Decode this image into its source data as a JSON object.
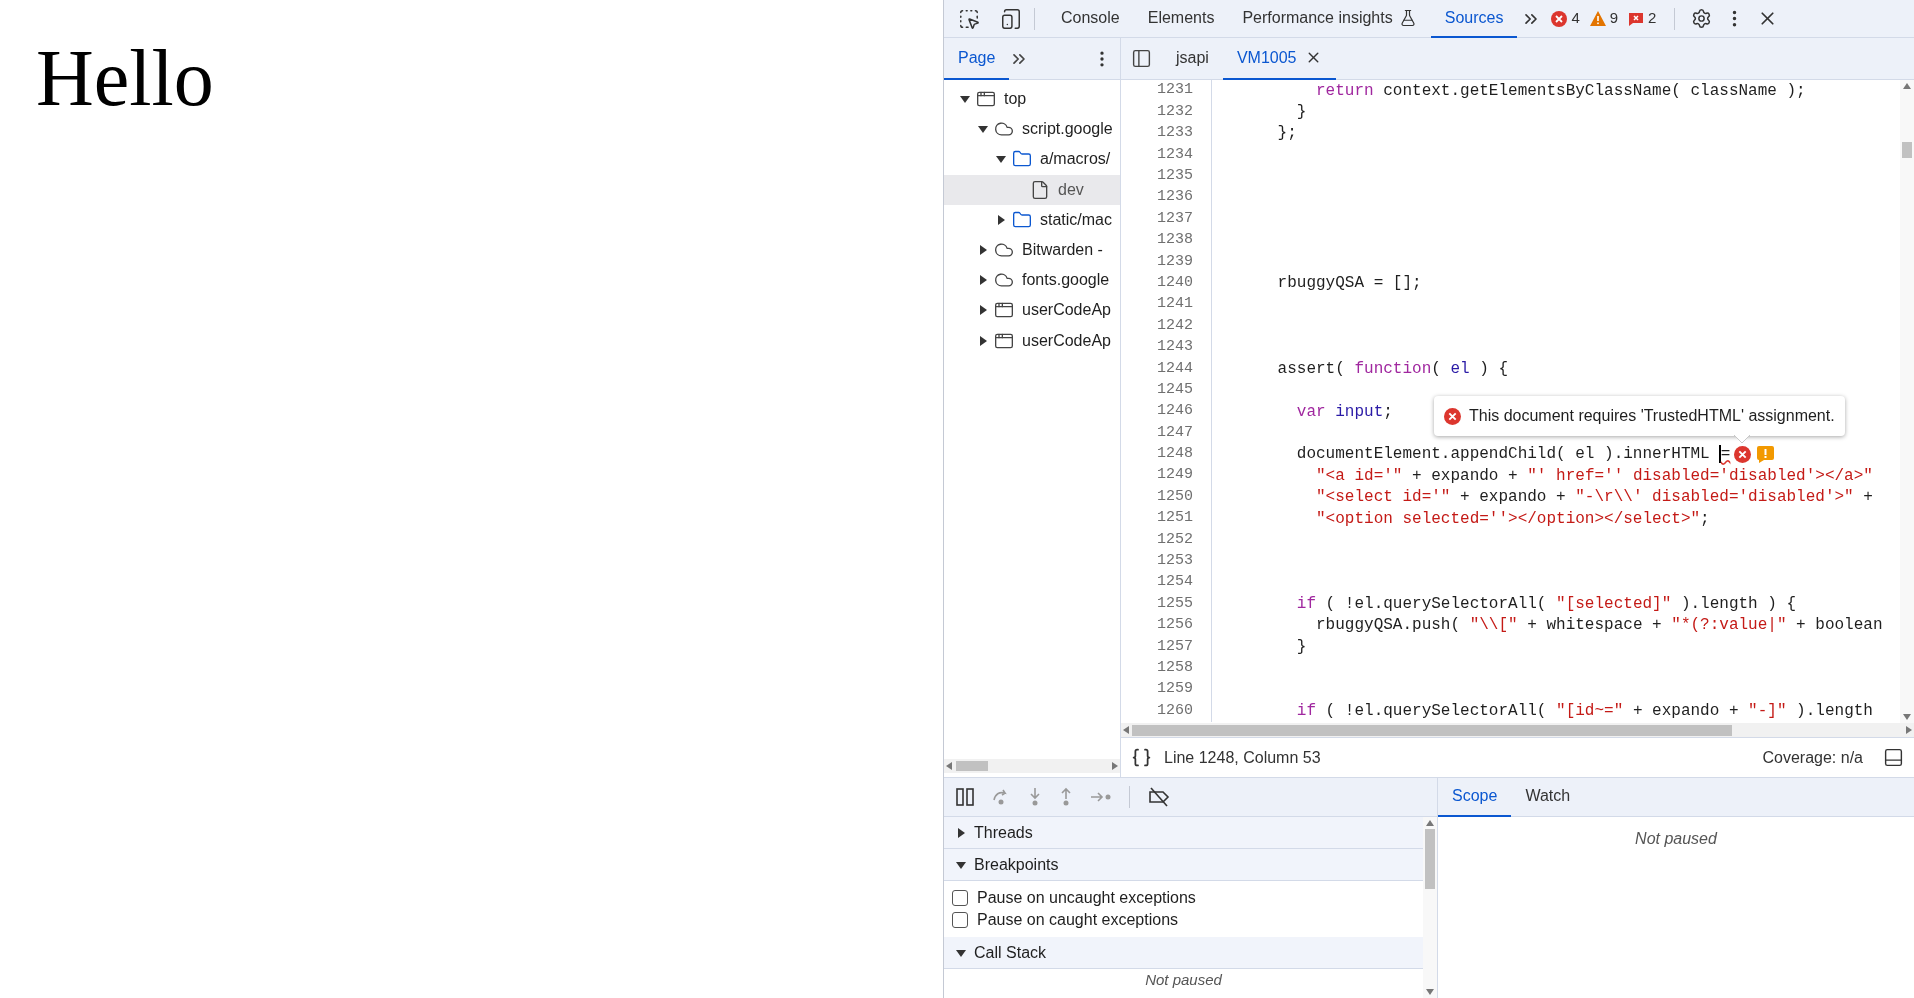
{
  "page": {
    "heading": "Hello"
  },
  "devtools": {
    "main_tabs": [
      {
        "label": "Console",
        "selected": false,
        "kind": "plain"
      },
      {
        "label": "Elements",
        "selected": false,
        "kind": "plain"
      },
      {
        "label": "Performance insights",
        "selected": false,
        "kind": "experimental"
      },
      {
        "label": "Sources",
        "selected": true,
        "kind": "plain"
      }
    ],
    "counters": [
      {
        "kind": "error",
        "count": "4"
      },
      {
        "kind": "warning",
        "count": "9"
      },
      {
        "kind": "issue",
        "count": "2"
      }
    ],
    "navigator": {
      "tabs": [
        {
          "label": "Page",
          "selected": true
        }
      ],
      "tree": [
        {
          "label": "top",
          "kind": "frame",
          "expanded": true,
          "selected": false,
          "children": [
            {
              "label": "script.google",
              "kind": "domain",
              "expanded": true,
              "selected": false,
              "children": [
                {
                  "label": "a/macros/",
                  "kind": "folder",
                  "expanded": true,
                  "selected": false,
                  "children": [
                    {
                      "label": "dev",
                      "kind": "file",
                      "selected": true
                    }
                  ]
                },
                {
                  "label": "static/mac",
                  "kind": "folder",
                  "expanded": false,
                  "selected": false
                }
              ]
            },
            {
              "label": "Bitwarden -",
              "kind": "domain",
              "expanded": false,
              "selected": false
            },
            {
              "label": "fonts.google",
              "kind": "domain",
              "expanded": false,
              "selected": false
            },
            {
              "label": "userCodeAp",
              "kind": "frame",
              "expanded": false,
              "selected": false
            },
            {
              "label": "userCodeAp",
              "kind": "frame",
              "expanded": false,
              "selected": false
            }
          ]
        }
      ]
    },
    "editor_tabs": [
      {
        "label": "jsapi",
        "selected": false,
        "closable": false
      },
      {
        "label": "VM1005",
        "selected": true,
        "closable": true
      }
    ],
    "code_lines": [
      {
        "number": "1231",
        "tokens": [
          {
            "text": "          return",
            "kind": "kw"
          },
          {
            "text": " context.getElementsByClassName( className );",
            "kind": "p"
          }
        ]
      },
      {
        "number": "1232",
        "tokens": [
          {
            "text": "        }",
            "kind": "p"
          }
        ]
      },
      {
        "number": "1233",
        "tokens": [
          {
            "text": "      };",
            "kind": "p"
          }
        ]
      },
      {
        "number": "1234"
      },
      {
        "number": "1235"
      },
      {
        "number": "1236"
      },
      {
        "number": "1237"
      },
      {
        "number": "1238"
      },
      {
        "number": "1239"
      },
      {
        "number": "1240",
        "tokens": [
          {
            "text": "      rbuggyQSA = [];",
            "kind": "p"
          }
        ]
      },
      {
        "number": "1241"
      },
      {
        "number": "1242"
      },
      {
        "number": "1243"
      },
      {
        "number": "1244",
        "tokens": [
          {
            "text": "      assert( ",
            "kind": "p"
          },
          {
            "text": "function",
            "kind": "kw"
          },
          {
            "text": "( ",
            "kind": "p"
          },
          {
            "text": "el",
            "kind": "var"
          },
          {
            "text": " ) {",
            "kind": "p"
          }
        ]
      },
      {
        "number": "1245"
      },
      {
        "number": "1246",
        "tokens": [
          {
            "text": "        var",
            "kind": "kw"
          },
          {
            "text": " input",
            "kind": "var"
          },
          {
            "text": ";",
            "kind": "p"
          }
        ]
      },
      {
        "number": "1247"
      },
      {
        "number": "1248",
        "tokens": [
          {
            "text": "        documentElement.appendChild( el ).innerHTML ",
            "kind": "p"
          },
          {
            "kind": "cursor"
          },
          {
            "text": "=",
            "kind": "err"
          }
        ],
        "markers": [
          {
            "kind": "error"
          },
          {
            "kind": "warning"
          }
        ]
      },
      {
        "number": "1249",
        "tokens": [
          {
            "text": "          \"<a id='\"",
            "kind": "str"
          },
          {
            "text": " + expando + ",
            "kind": "p"
          },
          {
            "text": "\"' href='' disabled='disabled'></a>\"",
            "kind": "str"
          }
        ]
      },
      {
        "number": "1250",
        "tokens": [
          {
            "text": "          \"<select id='\"",
            "kind": "str"
          },
          {
            "text": " + expando + ",
            "kind": "p"
          },
          {
            "text": "\"-\\r\\\\' disabled='disabled'>\"",
            "kind": "str"
          },
          {
            "text": " +",
            "kind": "p"
          }
        ]
      },
      {
        "number": "1251",
        "tokens": [
          {
            "text": "          \"<option selected=''></option></select>\"",
            "kind": "str"
          },
          {
            "text": ";",
            "kind": "p"
          }
        ]
      },
      {
        "number": "1252"
      },
      {
        "number": "1253"
      },
      {
        "number": "1254"
      },
      {
        "number": "1255",
        "tokens": [
          {
            "text": "        if",
            "kind": "kw"
          },
          {
            "text": " ( !el.querySelectorAll( ",
            "kind": "p"
          },
          {
            "text": "\"[selected]\"",
            "kind": "str"
          },
          {
            "text": " ).length ) {",
            "kind": "p"
          }
        ]
      },
      {
        "number": "1256",
        "tokens": [
          {
            "text": "          rbuggyQSA.push( ",
            "kind": "p"
          },
          {
            "text": "\"\\\\[\"",
            "kind": "str"
          },
          {
            "text": " + whitespace + ",
            "kind": "p"
          },
          {
            "text": "\"*(?:value|\"",
            "kind": "str"
          },
          {
            "text": " + boolean",
            "kind": "p"
          }
        ]
      },
      {
        "number": "1257",
        "tokens": [
          {
            "text": "        }",
            "kind": "p"
          }
        ]
      },
      {
        "number": "1258"
      },
      {
        "number": "1259"
      },
      {
        "number": "1260",
        "tokens": [
          {
            "text": "        if",
            "kind": "kw"
          },
          {
            "text": " ( !el.querySelectorAll( ",
            "kind": "p"
          },
          {
            "text": "\"[id~=\"",
            "kind": "str"
          },
          {
            "text": " + expando + ",
            "kind": "p"
          },
          {
            "text": "\"-]\"",
            "kind": "str"
          },
          {
            "text": " ).length",
            "kind": "p"
          }
        ]
      }
    ],
    "tooltip": {
      "kind": "error",
      "message": "This document requires 'TrustedHTML' assignment."
    },
    "status_bar": {
      "position": "Line 1248, Column 53",
      "coverage": "Coverage: n/a"
    },
    "debugger": {
      "sections": [
        {
          "title": "Threads",
          "expanded": false
        },
        {
          "title": "Breakpoints",
          "expanded": true,
          "options": [
            {
              "label": "Pause on uncaught exceptions",
              "checked": false
            },
            {
              "label": "Pause on caught exceptions",
              "checked": false
            }
          ]
        },
        {
          "title": "Call Stack",
          "expanded": true,
          "message": "Not paused"
        }
      ],
      "side_tabs": [
        {
          "label": "Scope",
          "selected": true
        },
        {
          "label": "Watch",
          "selected": false
        }
      ],
      "scope_message": "Not paused"
    }
  }
}
